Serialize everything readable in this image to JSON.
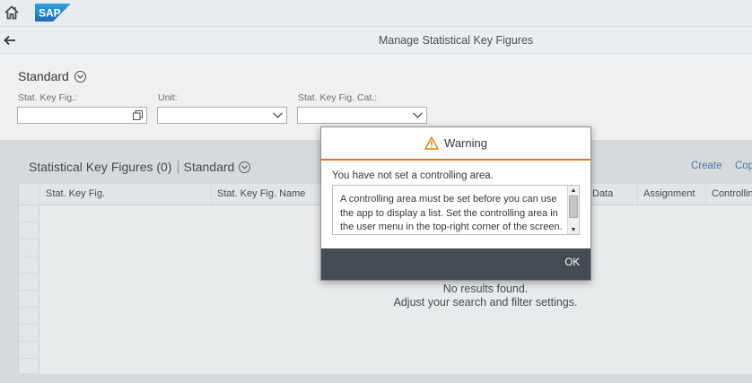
{
  "shell": {
    "home_icon": "home-icon",
    "logo_text": "SAP"
  },
  "titlebar": {
    "back_icon": "back-arrow-icon",
    "title": "Manage Statistical Key Figures"
  },
  "filterbar": {
    "variant_label": "Standard",
    "fields": [
      {
        "label": "Stat. Key Fig.:",
        "value": "",
        "icon": "value-help-icon"
      },
      {
        "label": "Unit:",
        "value": "",
        "icon": "chevron-down-icon"
      },
      {
        "label": "Stat. Key Fig. Cat.:",
        "value": "",
        "icon": "chevron-down-icon"
      }
    ]
  },
  "table": {
    "title": "Statistical Key Figures (0)",
    "variant_label": "Standard",
    "actions": {
      "create": "Create",
      "copy": "Cop"
    },
    "columns": [
      "Stat. Key Fig.",
      "Stat. Key Fig. Name",
      "Data",
      "Assignment",
      "Controlling"
    ],
    "empty_line1": "No results found.",
    "empty_line2": "Adjust your search and filter settings."
  },
  "dialog": {
    "icon": "warning-icon",
    "title": "Warning",
    "message": "You have not set a controlling area.",
    "details": "A controlling area must be set before you can use the app to display a list. Set the controlling area in the user menu in the top-right corner of the screen.",
    "ok_label": "OK"
  },
  "colors": {
    "warning": "#e07b00",
    "footer": "#454c51",
    "link": "#3a6ea5",
    "logo": "#1b75bb"
  }
}
